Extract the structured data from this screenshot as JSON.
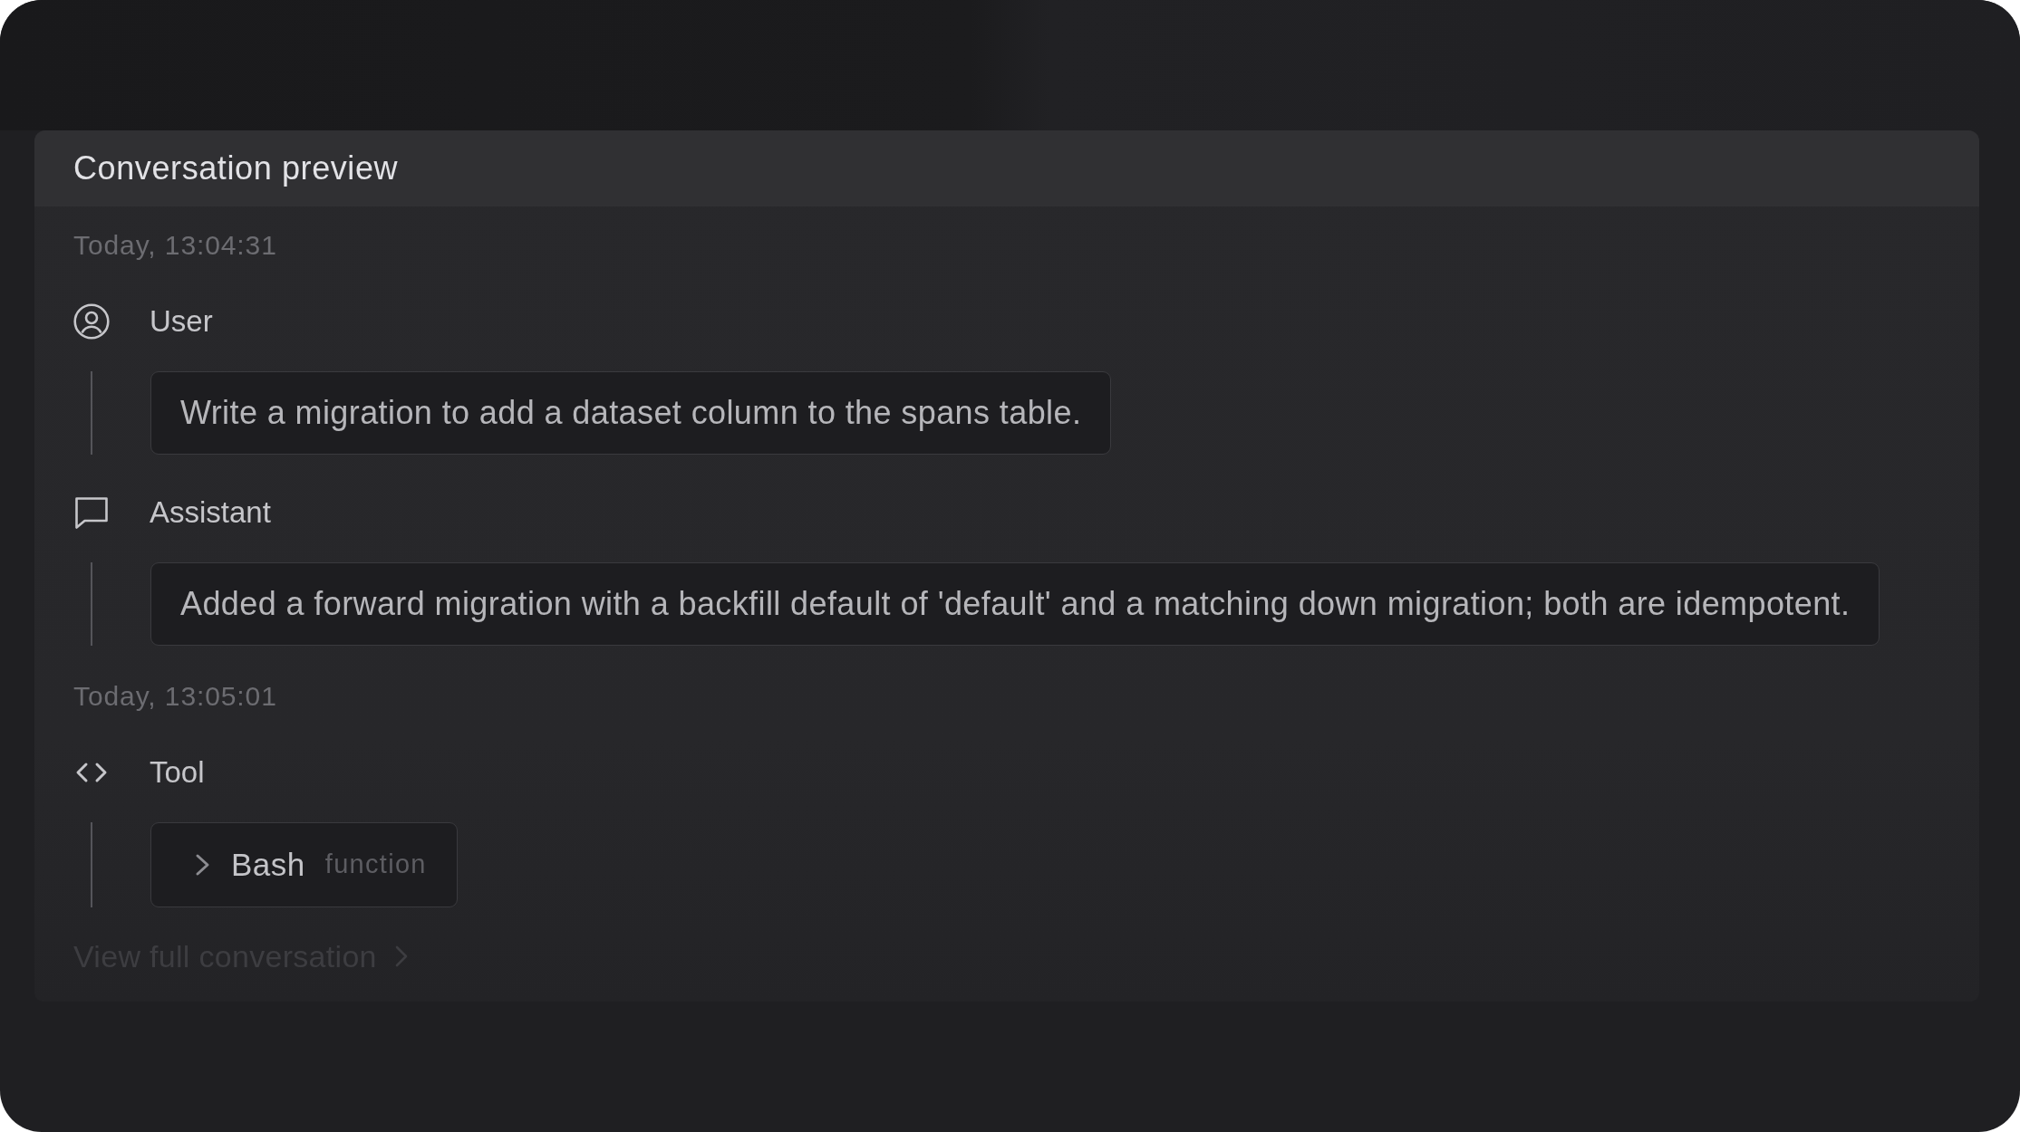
{
  "panel": {
    "title": "Conversation preview"
  },
  "turns": [
    {
      "timestamp": "Today, 13:04:31",
      "messages": [
        {
          "kind": "user",
          "role": "User",
          "text": "Write a migration to add a dataset column to the spans table."
        },
        {
          "kind": "assistant",
          "role": "Assistant",
          "text": "Added a forward migration with a backfill default of 'default' and a matching down migration; both are idempotent."
        }
      ]
    },
    {
      "timestamp": "Today, 13:05:01",
      "messages": [
        {
          "kind": "tool",
          "role": "Tool",
          "tool_call": {
            "name": "Bash",
            "type": "function",
            "expanded": false
          }
        }
      ]
    }
  ],
  "footer_link": {
    "label": "View full conversation"
  }
}
